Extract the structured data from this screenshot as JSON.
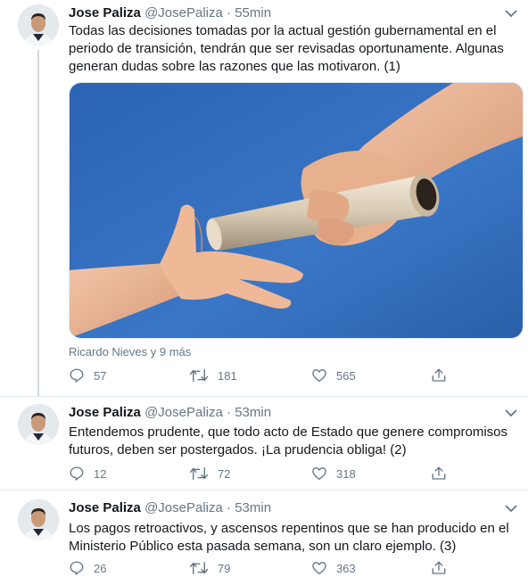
{
  "tweets": [
    {
      "name": "Jose Paliza",
      "handle": "@JosePaliza",
      "separator": "·",
      "time": "55min",
      "text_lines": [
        "Todas las decisiones tomadas por la actual gestión gubernamental en el",
        "periodo de transición, tendrán que ser revisadas oportunamente. Algunas",
        "generan dudas sobre las razones que las motivaron. (1)"
      ],
      "liked_by": "Ricardo Nieves y 9 más",
      "replies": "57",
      "retweets": "181",
      "likes": "565"
    },
    {
      "name": "Jose Paliza",
      "handle": "@JosePaliza",
      "separator": "·",
      "time": "53min",
      "text_lines": [
        "Entendemos prudente, que todo acto de Estado que genere compromisos",
        "futuros, deben ser postergados. ¡La prudencia obliga! (2)"
      ],
      "replies": "12",
      "retweets": "72",
      "likes": "318"
    },
    {
      "name": "Jose Paliza",
      "handle": "@JosePaliza",
      "separator": "·",
      "time": "53min",
      "text_lines": [
        "Los pagos retroactivos, y ascensos repentinos que se han producido en el",
        "Ministerio Público esta pasada semana, son un claro ejemplo. (3)"
      ],
      "replies": "26",
      "retweets": "79",
      "likes": "363"
    }
  ],
  "icons": {
    "reply": "reply-icon",
    "retweet": "retweet-icon",
    "like": "heart-icon",
    "share": "share-icon",
    "more": "chevron-down-icon"
  },
  "colors": {
    "text": "#14171a",
    "muted": "#657786",
    "thread_line": "#cfd9de",
    "photo_bg": "#2f66b8"
  }
}
